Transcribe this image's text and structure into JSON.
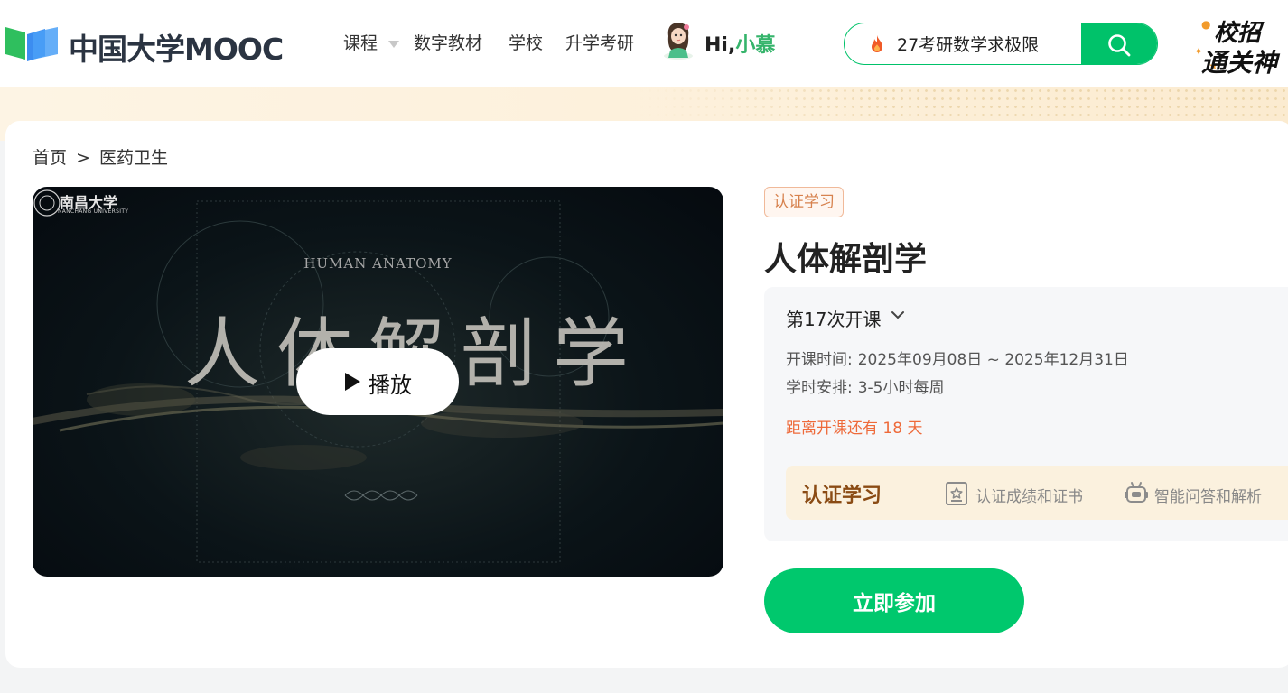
{
  "header": {
    "logo_text": "中国大学MOOC",
    "nav": [
      {
        "label": "课程",
        "has_dropdown": true
      },
      {
        "label": "数字教材"
      },
      {
        "label": "学校"
      },
      {
        "label": "升学考研"
      }
    ],
    "greeting_prefix": "Hi,",
    "greeting_name": "小慕",
    "search": {
      "value": "27考研数学求极限",
      "icon": "fire-icon",
      "button_icon": "search-icon"
    },
    "promo": {
      "line1": "校招",
      "line2": "通关神"
    }
  },
  "breadcrumb": {
    "home": "首页",
    "separator": ">",
    "category": "医药卫生"
  },
  "video": {
    "university": "南昌大学",
    "university_en": "NANCHANG UNIVERSITY",
    "subtitle": "HUMAN ANATOMY",
    "title": "人体解剖学",
    "play_label": "播放"
  },
  "course": {
    "badge": "认证学习",
    "title": "人体解剖学",
    "term": "第17次开课",
    "start_label": "开课时间:",
    "start_value": "2025年09月08日 ~ 2025年12月31日",
    "hours_label": "学时安排:",
    "hours_value": "3-5小时每周",
    "countdown": "距离开课还有 18 天",
    "cert": {
      "title": "认证学习",
      "features": [
        {
          "icon": "certificate-icon",
          "label": "认证成绩和证书"
        },
        {
          "icon": "robot-icon",
          "label": "智能问答和解析"
        }
      ]
    },
    "join_label": "立即参加"
  },
  "colors": {
    "brand_green": "#00c26a",
    "badge_orange": "#d7824e",
    "countdown_red": "#ee6a3a",
    "cert_brown": "#8a4b14"
  }
}
